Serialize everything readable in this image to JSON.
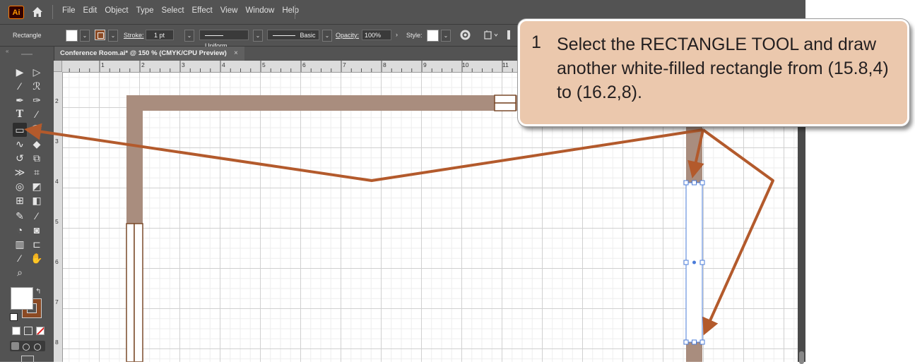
{
  "menubar": {
    "app_logo": "Ai",
    "items": [
      "File",
      "Edit",
      "Object",
      "Type",
      "Select",
      "Effect",
      "View",
      "Window",
      "Help"
    ]
  },
  "control_bar": {
    "tool_name": "Rectangle",
    "stroke_label": "Stroke:",
    "stroke_weight": "1 pt",
    "profile": "Uniform",
    "brush": "Basic",
    "opacity_label": "Opacity:",
    "opacity_value": "100%",
    "style_label": "Style:"
  },
  "document_tab": {
    "title": "Conference Room.ai* @ 150 % (CMYK/CPU Preview)",
    "close": "×"
  },
  "ruler": {
    "h_numbers": [
      "1",
      "2",
      "3",
      "4",
      "5",
      "6",
      "7",
      "8",
      "9",
      "10",
      "11"
    ],
    "v_numbers": [
      "2",
      "3",
      "4",
      "5",
      "6",
      "7",
      "8"
    ]
  },
  "callout": {
    "step": "1",
    "text": "Select the RECTANGLE TOOL and draw another white-filled rectangle from (15.8,4) to (16.2,8)."
  },
  "colors": {
    "wall": "#a98d7e",
    "wall_outline": "#7a4a2a",
    "arrow": "#b35a2c",
    "callout_bg": "#ebc8ad",
    "selection": "#4a7bd9"
  }
}
